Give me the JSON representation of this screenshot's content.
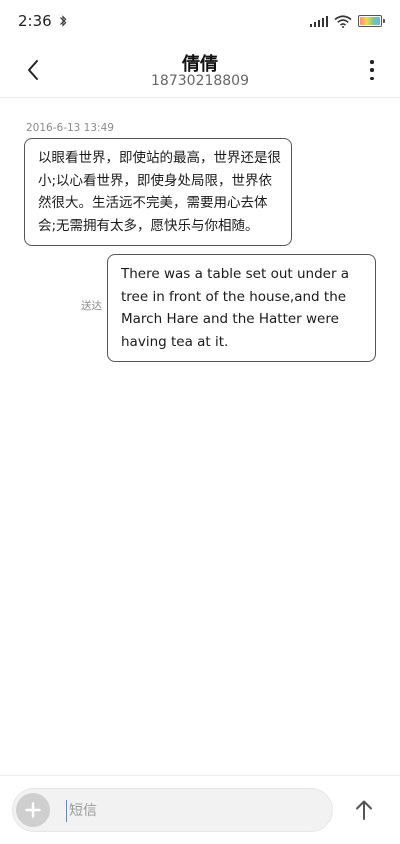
{
  "status_bar": {
    "time": "2:36"
  },
  "header": {
    "title": "倩倩",
    "subtitle": "18730218809"
  },
  "messages": [
    {
      "direction": "incoming",
      "timestamp": "2016-6-13 13:49",
      "text": "以眼看世界，即使站的最高，世界还是很小;以心看世界，即使身处局限，世界依然很大。生活远不完美，需要用心去体会;无需拥有太多，愿快乐与你相随。"
    },
    {
      "direction": "outgoing",
      "status": "送达",
      "text": "There was a table set out under a tree in front of the house,and the March Hare and the Hatter were having tea at it."
    }
  ],
  "input": {
    "placeholder": "短信"
  },
  "icons": {
    "back": "chevron-left-icon",
    "more": "more-vertical-icon",
    "add": "plus-icon",
    "send": "arrow-up-icon"
  }
}
